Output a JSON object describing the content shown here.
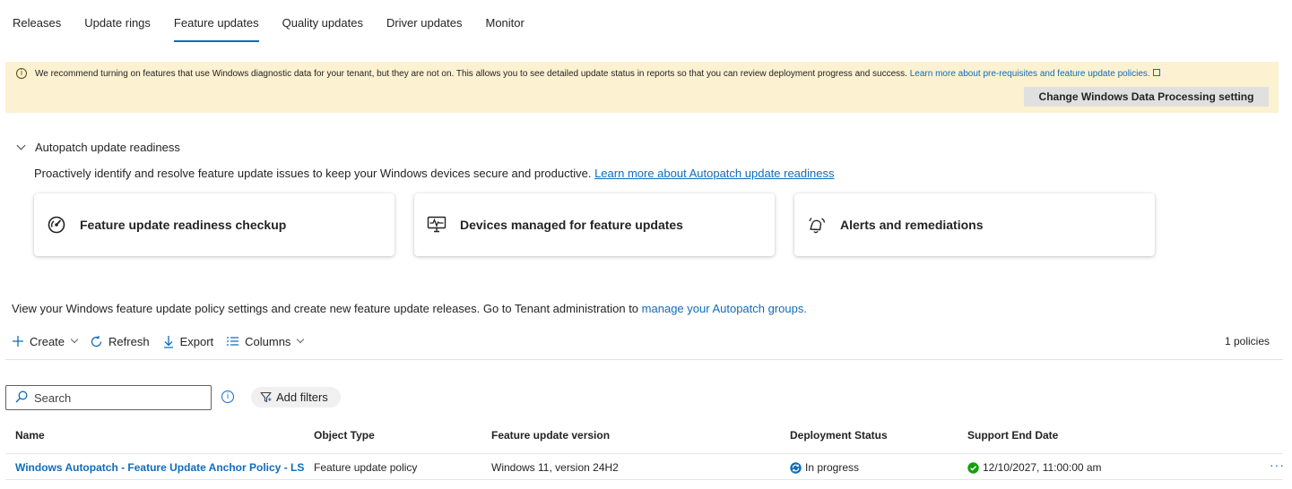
{
  "tabs": [
    {
      "label": "Releases"
    },
    {
      "label": "Update rings"
    },
    {
      "label": "Feature updates"
    },
    {
      "label": "Quality updates"
    },
    {
      "label": "Driver updates"
    },
    {
      "label": "Monitor"
    }
  ],
  "banner": {
    "message": "We recommend turning on features that use Windows diagnostic data for your tenant, but they are not on. This allows you to see detailed update status in reports so that you can review deployment progress and success.",
    "link": "Learn more about pre-requisites and feature update policies.",
    "button": "Change Windows Data Processing setting"
  },
  "autopatch": {
    "title": "Autopatch update readiness",
    "description": "Proactively identify and resolve feature update issues to keep your Windows devices secure and productive.",
    "link": "Learn more about Autopatch update readiness",
    "cards": [
      {
        "label": "Feature update readiness checkup",
        "icon": "gauge-icon"
      },
      {
        "label": "Devices managed for feature updates",
        "icon": "monitor-pulse-icon"
      },
      {
        "label": "Alerts and remediations",
        "icon": "alert-bell-icon"
      }
    ]
  },
  "policy": {
    "description": "View your Windows feature update policy settings and create new feature update releases. Go to Tenant administration to",
    "link": "manage your Autopatch groups."
  },
  "toolbar": {
    "create": "Create",
    "refresh": "Refresh",
    "export": "Export",
    "columns": "Columns",
    "count": "1 policies"
  },
  "search": {
    "placeholder": "Search"
  },
  "filters": {
    "add": "Add filters"
  },
  "table": {
    "headers": [
      "Name",
      "Object Type",
      "Feature update version",
      "Deployment Status",
      "Support End Date"
    ],
    "rows": [
      {
        "name": "Windows Autopatch - Feature Update Anchor Policy - LS-Wir",
        "object_type": "Feature update policy",
        "version": "Windows 11, version 24H2",
        "status": "In progress",
        "end_date": "12/10/2027, 11:00:00 am"
      }
    ]
  },
  "colors": {
    "accent": "#0f6cbd",
    "banner_bg": "#fcf1d0",
    "success": "#13a10e"
  }
}
